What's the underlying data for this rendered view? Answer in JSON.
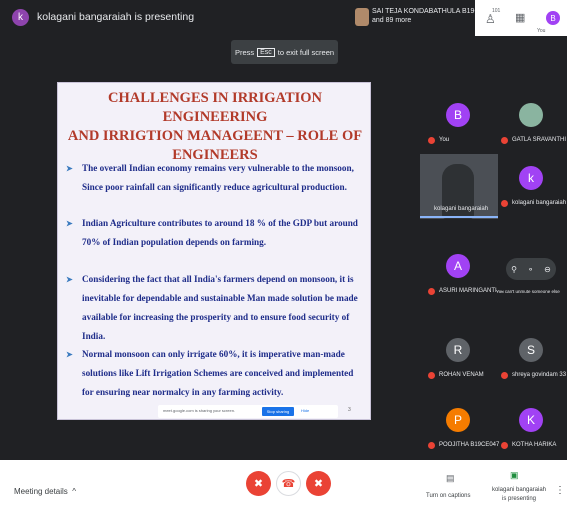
{
  "topbar": {
    "presenter_initial": "k",
    "presenter_text": "kolagani bangaraiah is presenting",
    "sharer_name": "SAI TEJA KONDABATHULA B19C...",
    "sharer_more": "and 89 more",
    "people_count": "101",
    "you_label": "You",
    "you_initial": "B"
  },
  "fullscreen": {
    "press": "Press",
    "key": "Esc",
    "rest": "to exit full screen"
  },
  "slide": {
    "title_lines": [
      "CHALLENGES IN IRRIGATION ENGINEERING",
      "AND IRRIGTION MANAGEENT – ROLE OF",
      "ENGINEERS"
    ],
    "bullets": [
      "The overall Indian economy remains very vulnerable to the monsoon, Since poor rainfall can significantly reduce agricultural production.",
      "Indian Agriculture contributes to around 18 % of the GDP but around 70% of Indian population depends on farming.",
      "Considering the fact that all India's farmers depend on monsoon, it is inevitable for dependable and sustainable  Man made solution be made available for increasing the prosperity and to ensure food security of India.",
      "Normal monsoon can only irrigate 60%, it is imperative man-made solutions like Lift Irrigation Schemes are conceived and implemented for ensuring near normalcy in any farming activity."
    ],
    "share_text": "meet.google.com is sharing your screen.",
    "stop_label": "Stop sharing",
    "hide_label": "Hide",
    "page_number": "3"
  },
  "participants": [
    {
      "initial": "B",
      "name": "You",
      "color": "#a142f4"
    },
    {
      "initial": "",
      "name": "GATLA SRAVANTHI",
      "color": "#8ab4a0"
    },
    {
      "initial": "",
      "name": "kolagani bangaraiah",
      "color": "#4b4f55"
    },
    {
      "initial": "k",
      "name": "kolagani bangaraiah",
      "color": "#a142f4"
    },
    {
      "initial": "A",
      "name": "ASURI MARINGANTI ...",
      "color": "#a142f4"
    },
    {
      "initial": "R",
      "name": "ROHAN VENAM",
      "color": "#5f6368"
    },
    {
      "initial": "S",
      "name": "shreya govindam 33",
      "color": "#5f6368"
    },
    {
      "initial": "P",
      "name": "POOJITHA B19CE047",
      "color": "#f57c00"
    },
    {
      "initial": "K",
      "name": "KOTHA HARIKA",
      "color": "#a142f4"
    }
  ],
  "remote_note": "You can't unmute someone else",
  "bottombar": {
    "meeting_details": "Meeting details",
    "captions_label": "Turn on captions",
    "present_label_1": "kolagani bangaraiah",
    "present_label_2": "is presenting"
  }
}
